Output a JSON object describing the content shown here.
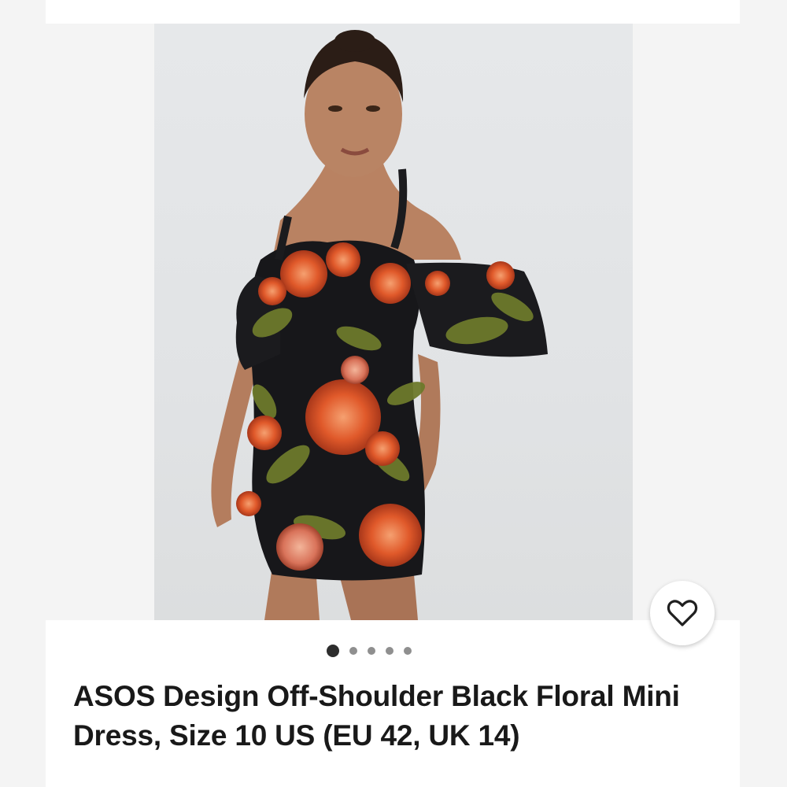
{
  "listing": {
    "title": "ASOS Design Off-Shoulder Black Floral Mini Dress, Size 10 US (EU 42, UK 14)",
    "image_alt": "Model wearing black floral off-shoulder mini dress"
  },
  "gallery": {
    "image_count": 5,
    "active_index": 0
  },
  "icons": {
    "favorite": "heart-outline-icon"
  },
  "colors": {
    "title_text": "#191919",
    "dot_active": "#2d2d2d",
    "dot_inactive": "#8f8f8f",
    "background": "#ffffff"
  }
}
